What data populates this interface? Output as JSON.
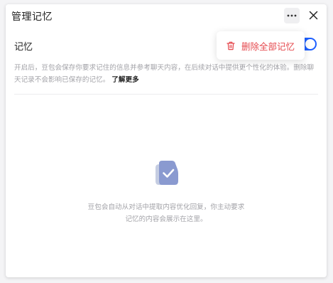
{
  "dialog": {
    "title": "管理记忆",
    "icons": {
      "more": "more-horizontal-icon",
      "close": "close-icon"
    }
  },
  "memory": {
    "label": "记忆",
    "enabled": true,
    "accent_color": "#1d5fff",
    "description": "开启后，豆包会保存你要求记住的信息并参考聊天内容，在后续对话中提供更个性化的体验。删除聊天记录不会影响已保存的记忆。",
    "learn_more": "了解更多"
  },
  "empty_state": {
    "icon": "memory-check-icon",
    "line1": "豆包会自动从对话中提取内容优化回复，你主动要求",
    "line2": "记忆的内容会展示在这里。"
  },
  "popup_menu": {
    "delete_all_label": "删除全部记忆",
    "delete_icon": "trash-icon",
    "danger_color": "#e5484d"
  }
}
